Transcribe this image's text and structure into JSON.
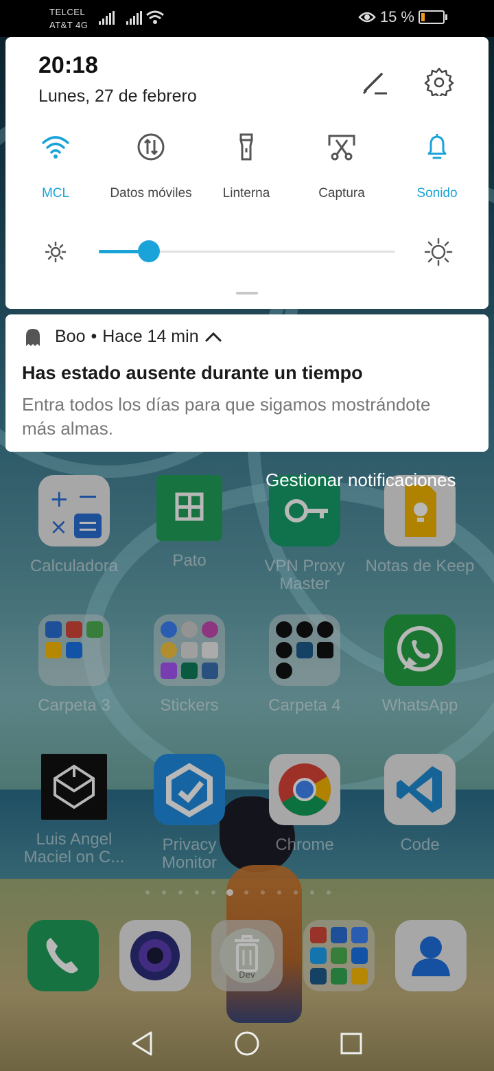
{
  "status_bar": {
    "carrier_1": "TELCEL",
    "carrier_2": "AT&T 4G",
    "battery_text": "15 %",
    "icons": [
      "signal-icon",
      "signal-icon",
      "wifi-icon",
      "eye-comfort-icon",
      "battery-icon"
    ],
    "battery_level": 0.15
  },
  "quick_settings": {
    "time": "20:18",
    "date": "Lunes, 27 de febrero",
    "tiles": [
      {
        "label": "MCL",
        "icon": "wifi-icon",
        "active": true
      },
      {
        "label": "Datos móviles",
        "icon": "mobile-data-icon",
        "active": false
      },
      {
        "label": "Linterna",
        "icon": "flashlight-icon",
        "active": false
      },
      {
        "label": "Captura",
        "icon": "screenshot-icon",
        "active": false
      },
      {
        "label": "Sonido",
        "icon": "bell-icon",
        "active": true
      }
    ],
    "brightness_level": 0.17,
    "accent_color": "#1aa3d9"
  },
  "notification": {
    "app": "Boo",
    "separator": "•",
    "time_ago": "Hace 14 min",
    "title": "Has estado ausente durante un tiempo",
    "text": "Entra todos los días para que sigamos mostrándote más almas."
  },
  "manage_notifications": "Gestionar notificaciones",
  "home_apps": [
    {
      "name": "Calculadora"
    },
    {
      "name": "Pato"
    },
    {
      "name": "VPN Proxy Master"
    },
    {
      "name": "Notas de Keep"
    },
    {
      "name": "Carpeta 3"
    },
    {
      "name": "Stickers"
    },
    {
      "name": "Carpeta 4"
    },
    {
      "name": "WhatsApp"
    },
    {
      "name": "Luis Angel Maciel on C..."
    },
    {
      "name": "Privacy Monitor"
    },
    {
      "name": "Chrome"
    },
    {
      "name": "Code"
    }
  ],
  "dock": {
    "items": [
      "phone-icon",
      "camera-icon",
      "trash-icon",
      "folder-icon",
      "contacts-icon"
    ],
    "badge_label": "Dev"
  },
  "page_indicator": {
    "count": 12,
    "active_index": 5
  },
  "nav_bar": [
    "back-icon",
    "home-icon",
    "recents-icon"
  ]
}
